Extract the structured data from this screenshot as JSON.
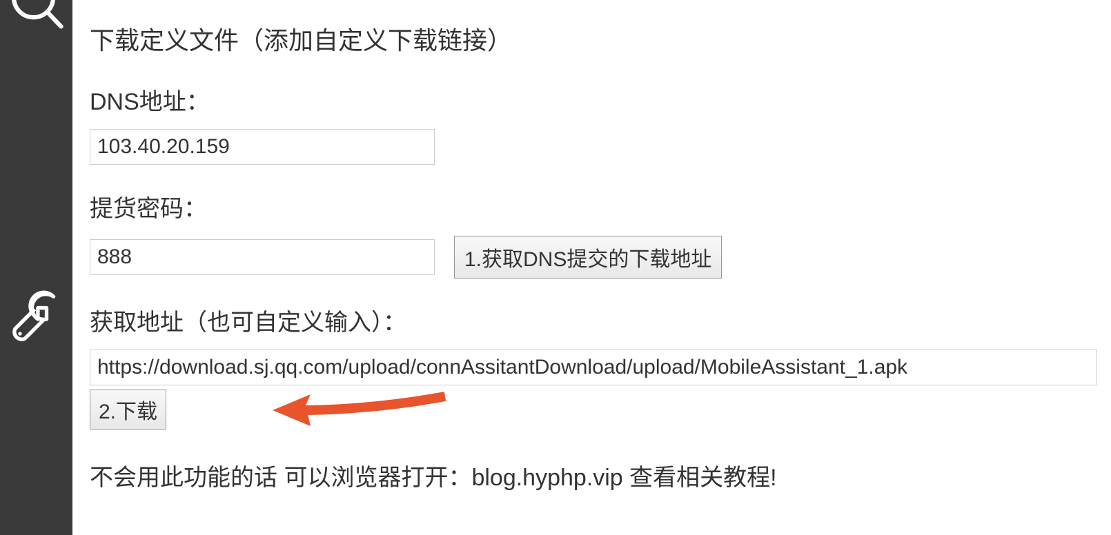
{
  "title": "下载定义文件（添加自定义下载链接）",
  "dns": {
    "label": "DNS地址：",
    "value": "103.40.20.159"
  },
  "password": {
    "label": "提货密码：",
    "value": "888"
  },
  "fetch_button": "1.获取DNS提交的下载地址",
  "url": {
    "label": "获取地址（也可自定义输入）：",
    "value": "https://download.sj.qq.com/upload/connAssitantDownload/upload/MobileAssistant_1.apk"
  },
  "download_button": "2.下载",
  "help_text": "不会用此功能的话 可以浏览器打开：blog.hyphp.vip 查看相关教程!"
}
